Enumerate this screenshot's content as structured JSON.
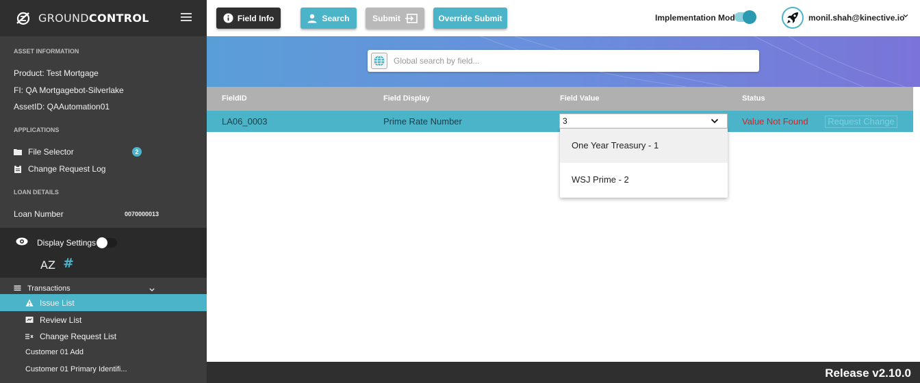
{
  "brand": {
    "name_light": "GROUND",
    "name_bold": "CONTROL"
  },
  "sidebar": {
    "asset_info": {
      "title": "ASSET INFORMATION",
      "product": "Product:  Test Mortgage",
      "fi": "FI:  QA Mortgagebot-Silverlake",
      "asset_id": "AssetID:  QAAutomation01"
    },
    "applications": {
      "title": "APPLICATIONS",
      "file_selector": "File Selector",
      "file_selector_badge": "2",
      "change_request_log": "Change Request Log"
    },
    "loan_details": {
      "title": "LOAN DETAILS",
      "loan_number_label": "Loan Number",
      "loan_number_value": "0070000013"
    },
    "display_settings": {
      "label": "Display Settings",
      "sort_icon_text": "AZ",
      "hash_icon_text": "#"
    },
    "transactions": {
      "label": "Transactions",
      "items": [
        "Issue List",
        "Review List",
        "Change Request List",
        "Customer 01 Add",
        "Customer 01 Primary Identifi..."
      ]
    }
  },
  "toolbar": {
    "field_info": "Field Info",
    "search": "Search",
    "submit": "Submit",
    "override_submit": "Override Submit",
    "implementation_mode": "Implementation Mode",
    "user_email": "monil.shah@kinective.io"
  },
  "search": {
    "placeholder": "Global search by field..."
  },
  "table": {
    "headers": {
      "field_id": "FieldID",
      "field_display": "Field Display",
      "field_value": "Field Value",
      "status": "Status"
    },
    "row": {
      "field_id": "LA06_0003",
      "field_display": "Prime Rate Number",
      "field_value": "3",
      "status": "Value Not Found",
      "action": "Request Change"
    }
  },
  "dropdown": {
    "options": [
      "One Year Treasury - 1",
      "WSJ Prime - 2"
    ]
  },
  "footer": {
    "release": "Release v2.10.0"
  },
  "colors": {
    "accent": "#4bb4c8",
    "sidebar": "#3d3d3d",
    "error": "#e02020"
  }
}
